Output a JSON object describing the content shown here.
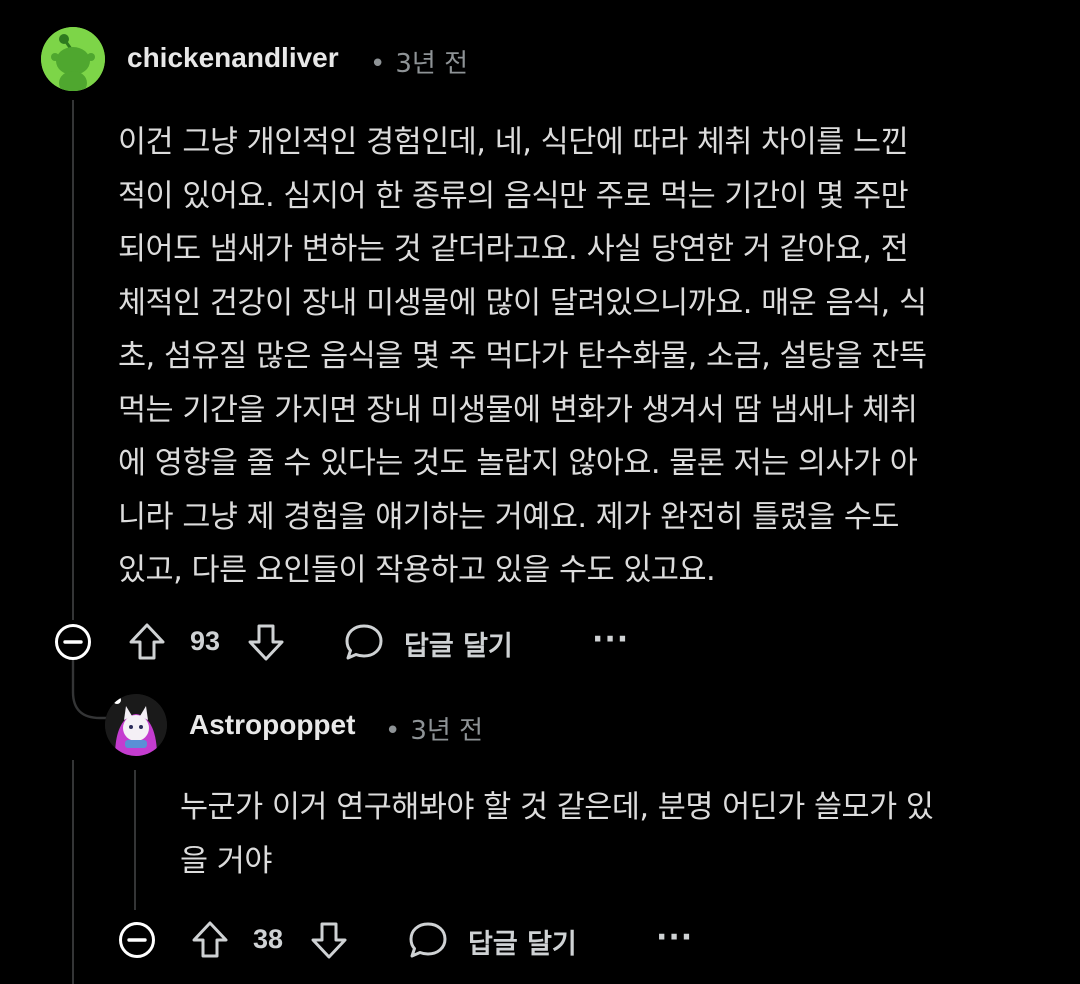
{
  "comments": [
    {
      "username": "chickenandliver",
      "meta_dot": "•",
      "time": "3년 전",
      "body_lines": [
        "이건 그냥 개인적인 경험인데, 네, 식단에 따라 체취 차이를 느낀",
        "적이 있어요. 심지어 한 종류의 음식만 주로 먹는 기간이 몇 주만",
        "되어도 냄새가 변하는 것 같더라고요. 사실 당연한 거 같아요, 전",
        "체적인 건강이 장내 미생물에 많이 달려있으니까요. 매운 음식, 식",
        "초, 섬유질 많은 음식을 몇 주 먹다가 탄수화물, 소금, 설탕을 잔뜩",
        "먹는 기간을 가지면 장내 미생물에 변화가 생겨서 땀 냄새나 체취",
        "에 영향을 줄 수 있다는 것도 놀랍지 않아요. 물론 저는 의사가 아",
        "니라 그냥 제 경험을 얘기하는 거예요. 제가 완전히 틀렸을 수도",
        "있고, 다른 요인들이 작용하고 있을 수도 있고요."
      ],
      "score": "93",
      "reply_label": "답글 달기",
      "more_label": "···",
      "avatar_icon": "reddit-snoo-avatar",
      "avatar_color": "#7dd548"
    },
    {
      "username": "Astropoppet",
      "meta_dot": "•",
      "time": "3년 전",
      "body_lines": [
        "누군가 이거 연구해봐야 할 것 같은데, 분명 어딘가 쓸모가 있",
        "을 거야"
      ],
      "score": "38",
      "reply_label": "답글 달기",
      "more_label": "···",
      "avatar_icon": "custom-cat-avatar",
      "avatar_color": "#c83cc8"
    }
  ],
  "colors": {
    "background": "#000000",
    "thread_line": "#343536",
    "text": "#dcdcdc",
    "meta": "#8e9396"
  }
}
